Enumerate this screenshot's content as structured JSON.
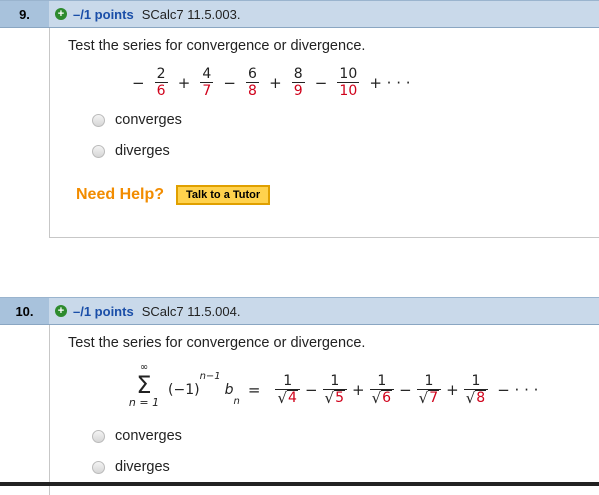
{
  "q9": {
    "number": "9.",
    "points": "–/1 points",
    "source": "SCalc7 11.5.003.",
    "prompt": "Test the series for convergence or divergence.",
    "series": [
      {
        "sign": "−",
        "num": "2",
        "den": "6"
      },
      {
        "sign": "+",
        "num": "4",
        "den": "7"
      },
      {
        "sign": "−",
        "num": "6",
        "den": "8"
      },
      {
        "sign": "+",
        "num": "8",
        "den": "9"
      },
      {
        "sign": "−",
        "num": "10",
        "den": "10"
      }
    ],
    "tail": "+ · · ·",
    "options": [
      "converges",
      "diverges"
    ],
    "need_help": "Need Help?",
    "tutor_button": "Talk to a Tutor"
  },
  "q10": {
    "number": "10.",
    "points": "–/1 points",
    "source": "SCalc7 11.5.004.",
    "prompt": "Test the series for convergence or divergence.",
    "sum_upper": "∞",
    "sum_lower": "n = 1",
    "sum_symbol": "Σ",
    "general_term": "(−1)",
    "exponent": "n−1",
    "bterm": "b",
    "bsub": "n",
    "equals": "=",
    "terms": [
      {
        "sign": "",
        "num": "1",
        "rad": "4"
      },
      {
        "sign": "−",
        "num": "1",
        "rad": "5"
      },
      {
        "sign": "+",
        "num": "1",
        "rad": "6"
      },
      {
        "sign": "−",
        "num": "1",
        "rad": "7"
      },
      {
        "sign": "+",
        "num": "1",
        "rad": "8"
      }
    ],
    "tail": "− · · ·",
    "options": [
      "converges",
      "diverges"
    ]
  },
  "colors": {
    "header_dark": "#a8c2dc",
    "header_light": "#c9d9ea",
    "points_blue": "#1a4ea8",
    "denominator_red": "#d0021b",
    "help_orange": "#f28c00",
    "tutor_yellow": "#ffd24d"
  }
}
